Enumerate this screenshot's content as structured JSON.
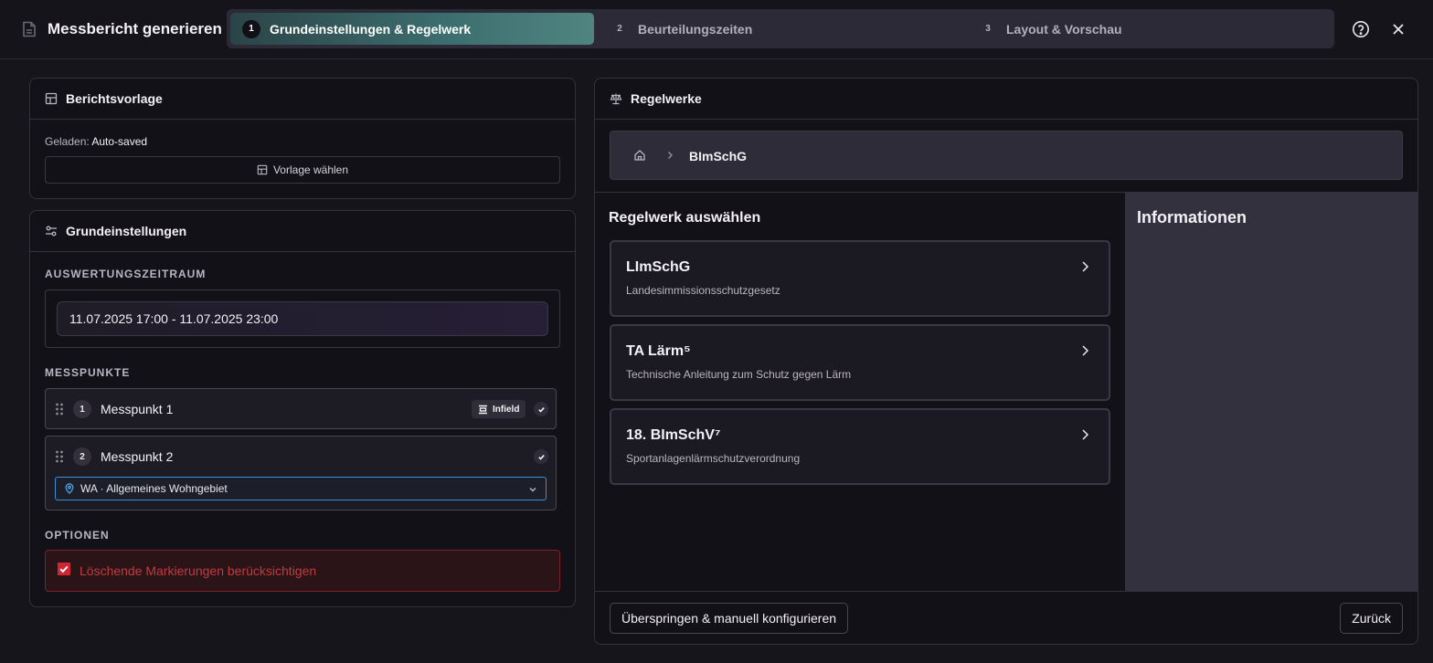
{
  "header": {
    "title": "Messbericht generieren",
    "steps": [
      {
        "num": "1",
        "label": "Grundeinstellungen & Regelwerk",
        "active": true
      },
      {
        "num": "2",
        "label": "Beurteilungszeiten",
        "active": false
      },
      {
        "num": "3",
        "label": "Layout & Vorschau",
        "active": false
      }
    ],
    "icons": {
      "doc": "document-icon",
      "help": "help-circle-icon",
      "close": "close-icon"
    }
  },
  "template_panel": {
    "title": "Berichtsvorlage",
    "loaded_label": "Geladen:",
    "loaded_value": "Auto-saved",
    "choose_button": "Vorlage wählen"
  },
  "basic_panel": {
    "title": "Grundeinstellungen",
    "range_label": "AUSWERTUNGSZEITRAUM",
    "range_value": "11.07.2025 17:00 - 11.07.2025 23:00",
    "points_label": "MESSPUNKTE",
    "points": [
      {
        "num": "1",
        "name": "Messpunkt 1",
        "badge": "Infield"
      },
      {
        "num": "2",
        "name": "Messpunkt 2",
        "zone": "WA · Allgemeines Wohngebiet"
      }
    ],
    "options_label": "OPTIONEN",
    "option_delete_marks": "Löschende Markierungen berücksichtigen"
  },
  "rules_panel": {
    "title": "Regelwerke",
    "breadcrumb_current": "BImSchG",
    "list_title": "Regelwerk auswählen",
    "rules": [
      {
        "title": "LImSchG",
        "desc": "Landesimmissionsschutzgesetz"
      },
      {
        "title": "TA Lärm⁵",
        "desc": "Technische Anleitung zum Schutz gegen Lärm"
      },
      {
        "title": "18. BImSchV⁷",
        "desc": "Sportanlagenlärmschutzverordnung"
      }
    ],
    "info_title": "Informationen",
    "skip_button": "Überspringen & manuell konfigurieren",
    "back_button": "Zurück"
  },
  "colors": {
    "background": "#17151c",
    "accent_teal": "#3d6e6f",
    "error_red": "#c23a3f",
    "focus_blue": "#3b8fd6"
  }
}
